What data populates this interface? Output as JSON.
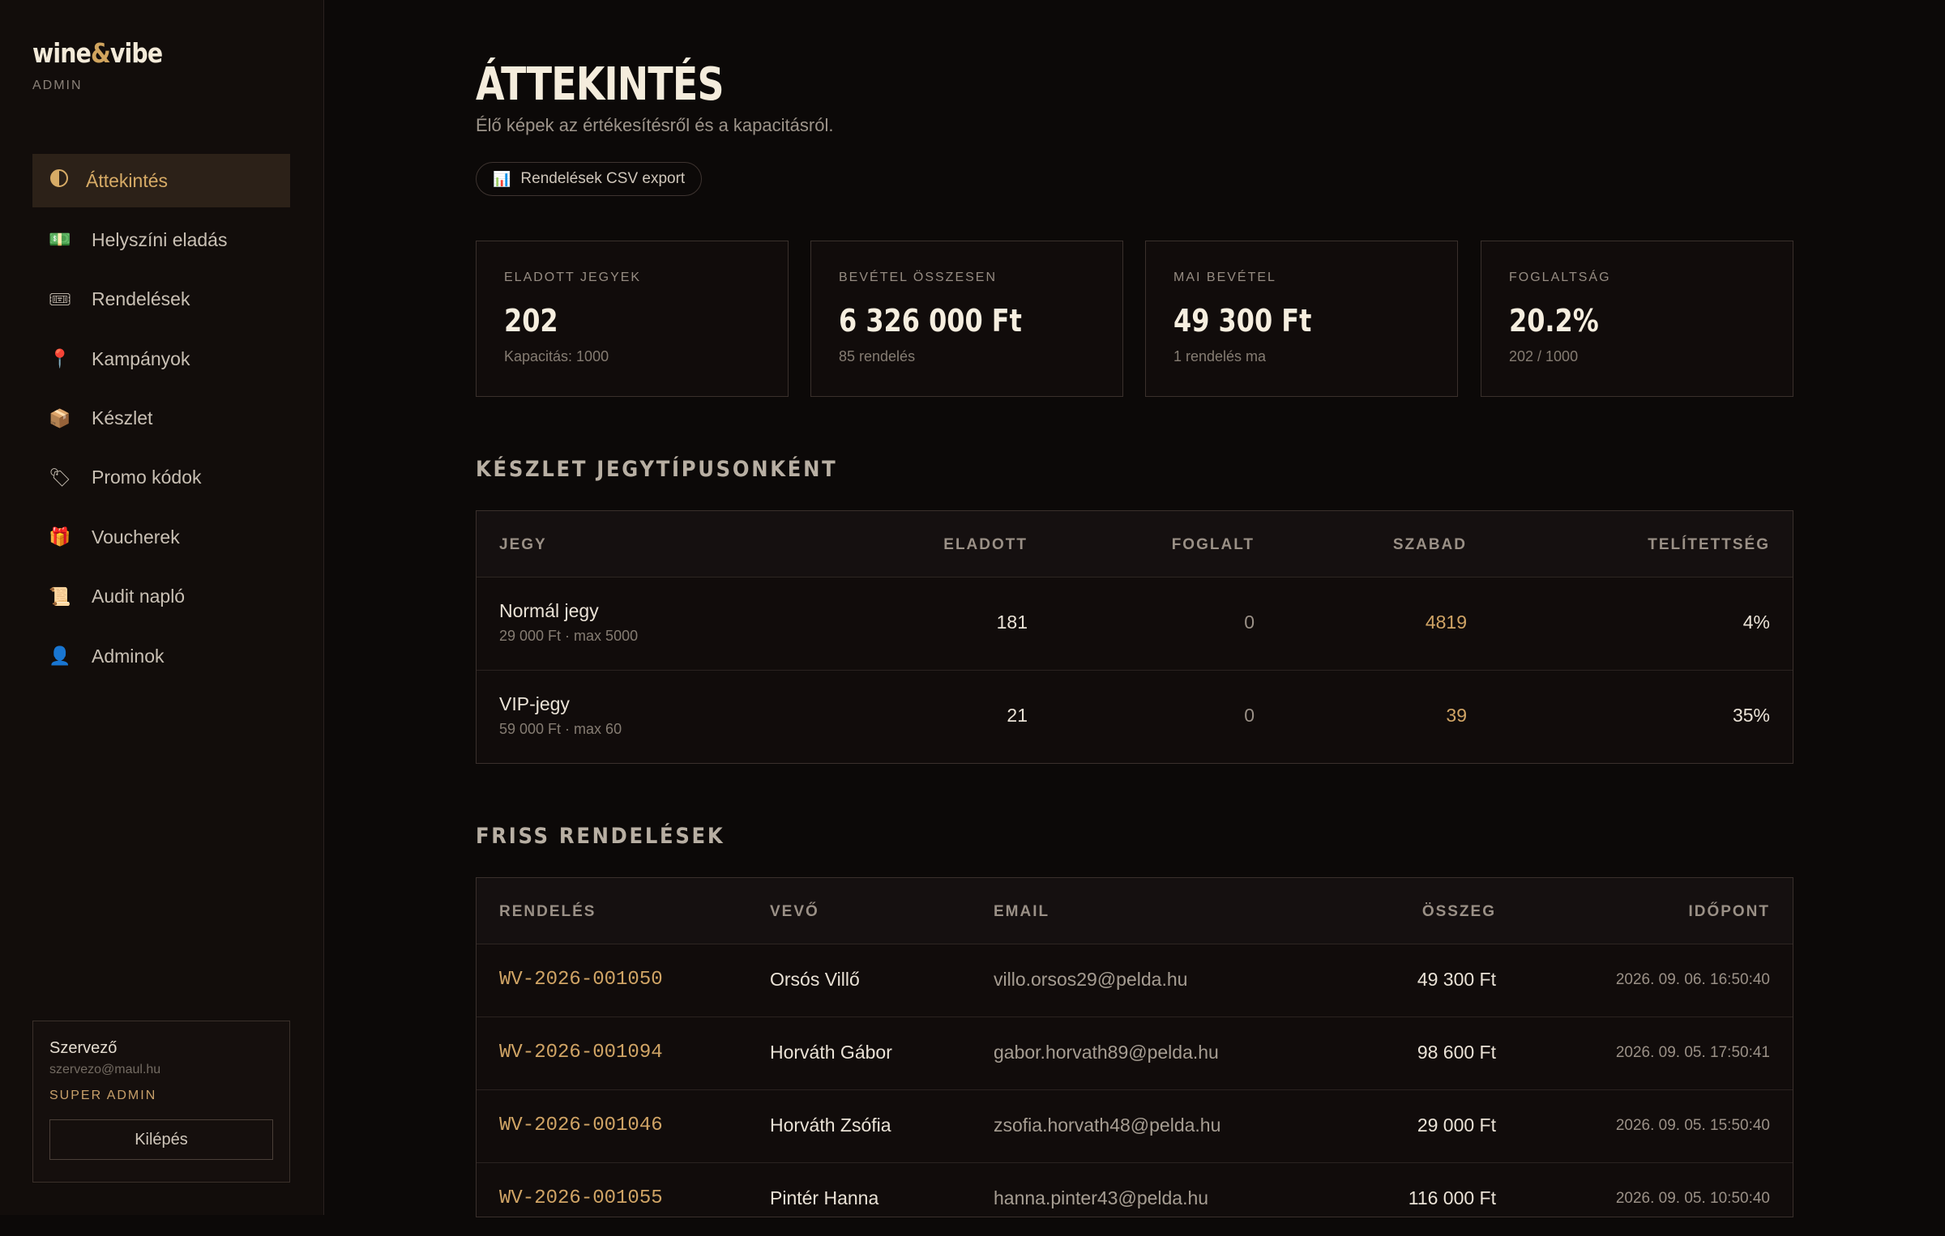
{
  "brand": {
    "name_a": "wine",
    "amp": "&",
    "name_b": "vibe",
    "sub": "ADMIN"
  },
  "nav": [
    {
      "label": "Áttekintés",
      "icon": "half-circle-icon",
      "glyph": "",
      "active": true
    },
    {
      "label": "Helyszíni eladás",
      "icon": "cash-icon",
      "glyph": "💵"
    },
    {
      "label": "Rendelések",
      "icon": "ticket-icon",
      "glyph": "🎟"
    },
    {
      "label": "Kampányok",
      "icon": "pin-icon",
      "glyph": "📍"
    },
    {
      "label": "Készlet",
      "icon": "box-icon",
      "glyph": "📦"
    },
    {
      "label": "Promo kódok",
      "icon": "tag-icon",
      "glyph": "🏷"
    },
    {
      "label": "Voucherek",
      "icon": "gift-icon",
      "glyph": "🎁"
    },
    {
      "label": "Audit napló",
      "icon": "scroll-icon",
      "glyph": "📜"
    },
    {
      "label": "Adminok",
      "icon": "user-icon",
      "glyph": "👤"
    }
  ],
  "user": {
    "name": "Szervező",
    "email": "szervezo@maul.hu",
    "role": "SUPER ADMIN",
    "logout_label": "Kilépés"
  },
  "header": {
    "title": "ÁTTEKINTÉS",
    "subtitle": "Élő képek az értékesítésről és a kapacitásról.",
    "export_icon": "📊",
    "export_label": "Rendelések CSV export"
  },
  "kpis": [
    {
      "label": "ELADOTT JEGYEK",
      "value": "202",
      "note": "Kapacitás: 1000"
    },
    {
      "label": "BEVÉTEL ÖSSZESEN",
      "value": "6 326 000 Ft",
      "note": "85 rendelés"
    },
    {
      "label": "MAI BEVÉTEL",
      "value": "49 300 Ft",
      "note": "1 rendelés ma"
    },
    {
      "label": "FOGLALTSÁG",
      "value": "20.2%",
      "note": "202 / 1000"
    }
  ],
  "stock": {
    "title": "KÉSZLET JEGYTÍPUSONKÉNT",
    "headers": {
      "ticket": "JEGY",
      "sold": "ELADOTT",
      "reserved": "FOGLALT",
      "free": "SZABAD",
      "fill": "TELÍTETTSÉG"
    },
    "rows": [
      {
        "name": "Normál jegy",
        "detail": "29 000 Ft · max 5000",
        "sold": "181",
        "reserved": "0",
        "free": "4819",
        "fill": "4%"
      },
      {
        "name": "VIP-jegy",
        "detail": "59 000 Ft · max 60",
        "sold": "21",
        "reserved": "0",
        "free": "39",
        "fill": "35%"
      }
    ]
  },
  "orders": {
    "title": "FRISS RENDELÉSEK",
    "headers": {
      "id": "RENDELÉS",
      "buyer": "VEVŐ",
      "email": "EMAIL",
      "total": "ÖSSZEG",
      "time": "IDŐPONT"
    },
    "rows": [
      {
        "id": "WV-2026-001050",
        "buyer": "Orsós Villő",
        "email": "villo.orsos29@pelda.hu",
        "total": "49 300 Ft",
        "time": "2026. 09. 06. 16:50:40"
      },
      {
        "id": "WV-2026-001094",
        "buyer": "Horváth Gábor",
        "email": "gabor.horvath89@pelda.hu",
        "total": "98 600 Ft",
        "time": "2026. 09. 05. 17:50:41"
      },
      {
        "id": "WV-2026-001046",
        "buyer": "Horváth Zsófia",
        "email": "zsofia.horvath48@pelda.hu",
        "total": "29 000 Ft",
        "time": "2026. 09. 05. 15:50:40"
      },
      {
        "id": "WV-2026-001055",
        "buyer": "Pintér Hanna",
        "email": "hanna.pinter43@pelda.hu",
        "total": "116 000 Ft",
        "time": "2026. 09. 05. 10:50:40"
      }
    ]
  },
  "colors": {
    "accent": "#d0a465",
    "background": "#0c0908",
    "sidebar": "#120d0b"
  }
}
